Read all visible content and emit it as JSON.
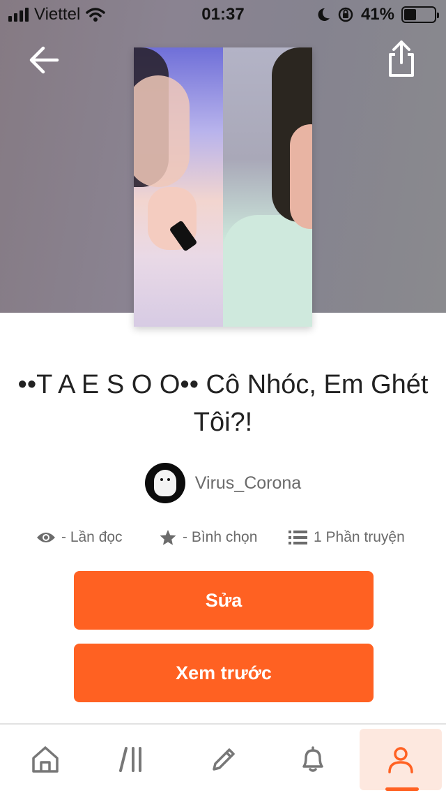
{
  "status_bar": {
    "carrier": "Viettel",
    "time": "01:37",
    "battery": "41%",
    "battery_level": 0.41
  },
  "header": {
    "back_icon": "arrow-left-icon",
    "share_icon": "share-icon"
  },
  "story": {
    "title": "••T A E S O O•• Cô Nhóc, Em Ghét Tôi?!",
    "author": "Virus_Corona"
  },
  "stats": {
    "reads": "- Lần đọc",
    "votes": "- Bình chọn",
    "parts": "1 Phần truyện"
  },
  "actions": {
    "edit_label": "Sửa",
    "preview_label": "Xem trước"
  },
  "tabbar": {
    "items": [
      {
        "icon": "home-icon"
      },
      {
        "icon": "library-icon"
      },
      {
        "icon": "pencil-icon"
      },
      {
        "icon": "bell-icon"
      },
      {
        "icon": "profile-icon",
        "active": true
      }
    ]
  },
  "colors": {
    "accent": "#ff6122",
    "active_tab_bg": "#fde8df",
    "muted_text": "#6b6b6b"
  }
}
